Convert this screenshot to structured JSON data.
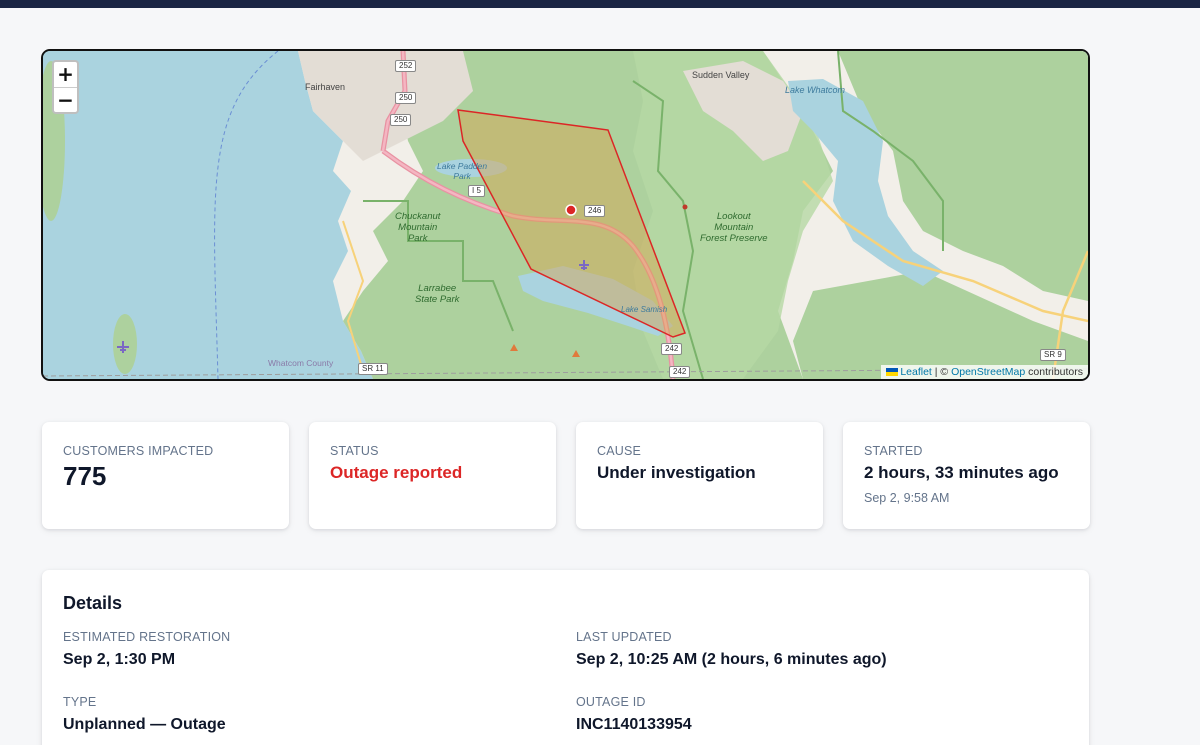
{
  "map": {
    "zoom_in": "+",
    "zoom_out": "−",
    "attribution": {
      "leaflet": "Leaflet",
      "separator": "| ©",
      "osm": "OpenStreetMap",
      "contributors": "contributors"
    },
    "labels": {
      "fairhaven": "Fairhaven",
      "sudden_valley": "Sudden Valley",
      "lake_whatcom": "Lake Whatcom",
      "lake_padden_park": "Lake Padden\nPark",
      "chuckanut_park": "Chuckanut\nMountain\nPark",
      "lookout_mountain": "Lookout\nMountain\nForest Preserve",
      "larrabee": "Larrabee\nState Park",
      "lake_samish": "Lake Samish",
      "whatcom_county": "Whatcom County"
    },
    "shields": {
      "i5": "I 5",
      "sr11": "SR 11",
      "sr9": "SR 9",
      "exit252": "252",
      "exit250a": "250",
      "exit250b": "250",
      "exit246": "246",
      "exit242a": "242",
      "exit242b": "242"
    },
    "colors": {
      "water": "#aad3df",
      "forest": "#add19e",
      "outage_polygon": "#dc2626"
    }
  },
  "cards": [
    {
      "label": "CUSTOMERS IMPACTED",
      "value": "775"
    },
    {
      "label": "STATUS",
      "value": "Outage reported",
      "color": "#dc2626"
    },
    {
      "label": "CAUSE",
      "value": "Under investigation"
    },
    {
      "label": "STARTED",
      "value": "2 hours, 33 minutes ago",
      "sub": "Sep 2, 9:58 AM"
    }
  ],
  "details": {
    "title": "Details",
    "estimated_restoration": {
      "label": "ESTIMATED RESTORATION",
      "value": "Sep 2, 1:30 PM"
    },
    "last_updated": {
      "label": "LAST UPDATED",
      "value": "Sep 2, 10:25 AM (2 hours, 6 minutes ago)"
    },
    "type": {
      "label": "TYPE",
      "value": "Unplanned — Outage"
    },
    "outage_id": {
      "label": "OUTAGE ID",
      "value": "INC1140133954"
    }
  }
}
